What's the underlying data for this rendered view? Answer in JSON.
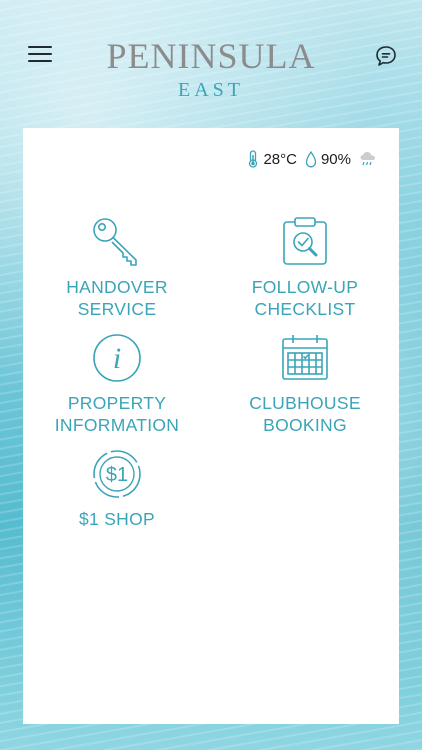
{
  "header": {
    "logo_main": "PENINSULA",
    "logo_sub": "EAST",
    "menu_icon": "hamburger-menu-icon",
    "chat_icon": "chat-bubble-icon"
  },
  "weather": {
    "temperature": "28°C",
    "humidity": "90%",
    "temp_icon": "thermometer-icon",
    "humidity_icon": "water-drop-icon",
    "condition_icon": "rain-cloud-icon"
  },
  "tiles": [
    {
      "label": "HANDOVER\nSERVICE",
      "icon": "key-icon"
    },
    {
      "label": "FOLLOW-UP\nCHECKLIST",
      "icon": "clipboard-check-icon"
    },
    {
      "label": "PROPERTY\nINFORMATION",
      "icon": "info-icon"
    },
    {
      "label": "CLUBHOUSE\nBOOKING",
      "icon": "calendar-icon"
    },
    {
      "label": "$1 SHOP",
      "icon": "dollar-coin-icon"
    }
  ],
  "colors": {
    "accent": "#3aa5b8",
    "logo_grey": "#8c8c8c"
  }
}
